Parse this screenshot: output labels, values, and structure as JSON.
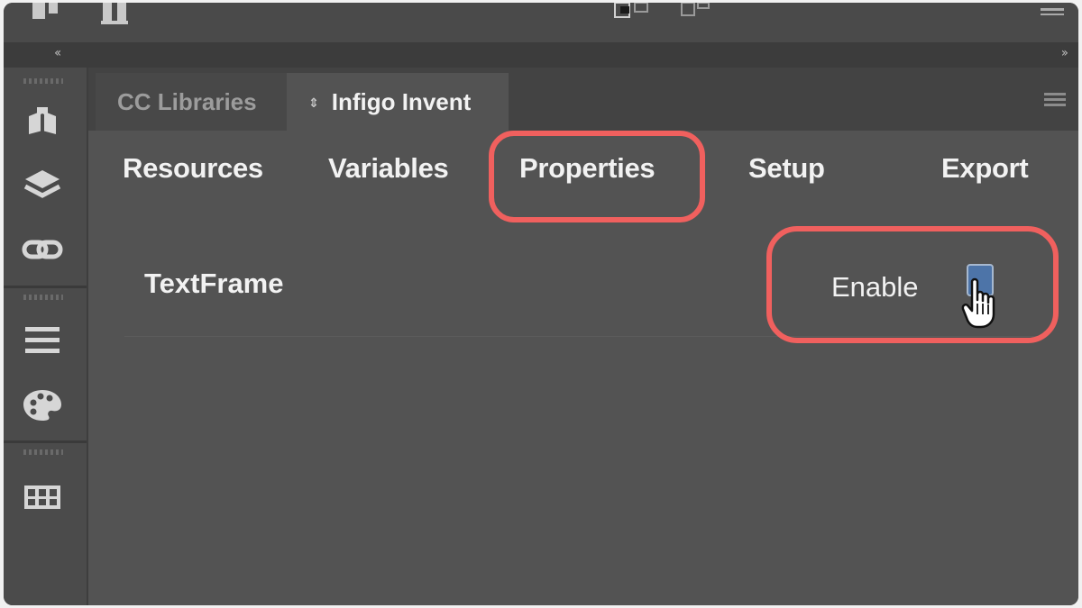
{
  "panel": {
    "tabs": [
      {
        "label": "CC Libraries",
        "active": false
      },
      {
        "label": "Infigo Invent",
        "active": true,
        "arrows": "⇕"
      }
    ]
  },
  "nav": {
    "items": [
      "Resources",
      "Variables",
      "Properties",
      "Setup",
      "Export"
    ],
    "highlighted": "Properties"
  },
  "row": {
    "label": "TextFrame",
    "enable_label": "Enable",
    "enable_checked": false
  },
  "colors": {
    "highlight": "#f0605e",
    "panel_bg": "#535353",
    "checkbox_fill": "#4d74a8"
  },
  "icons": [
    "hand-cursor-icon",
    "book-icon",
    "layers-icon",
    "links-icon",
    "menu-lines-icon",
    "palette-icon",
    "swatches-icon"
  ]
}
